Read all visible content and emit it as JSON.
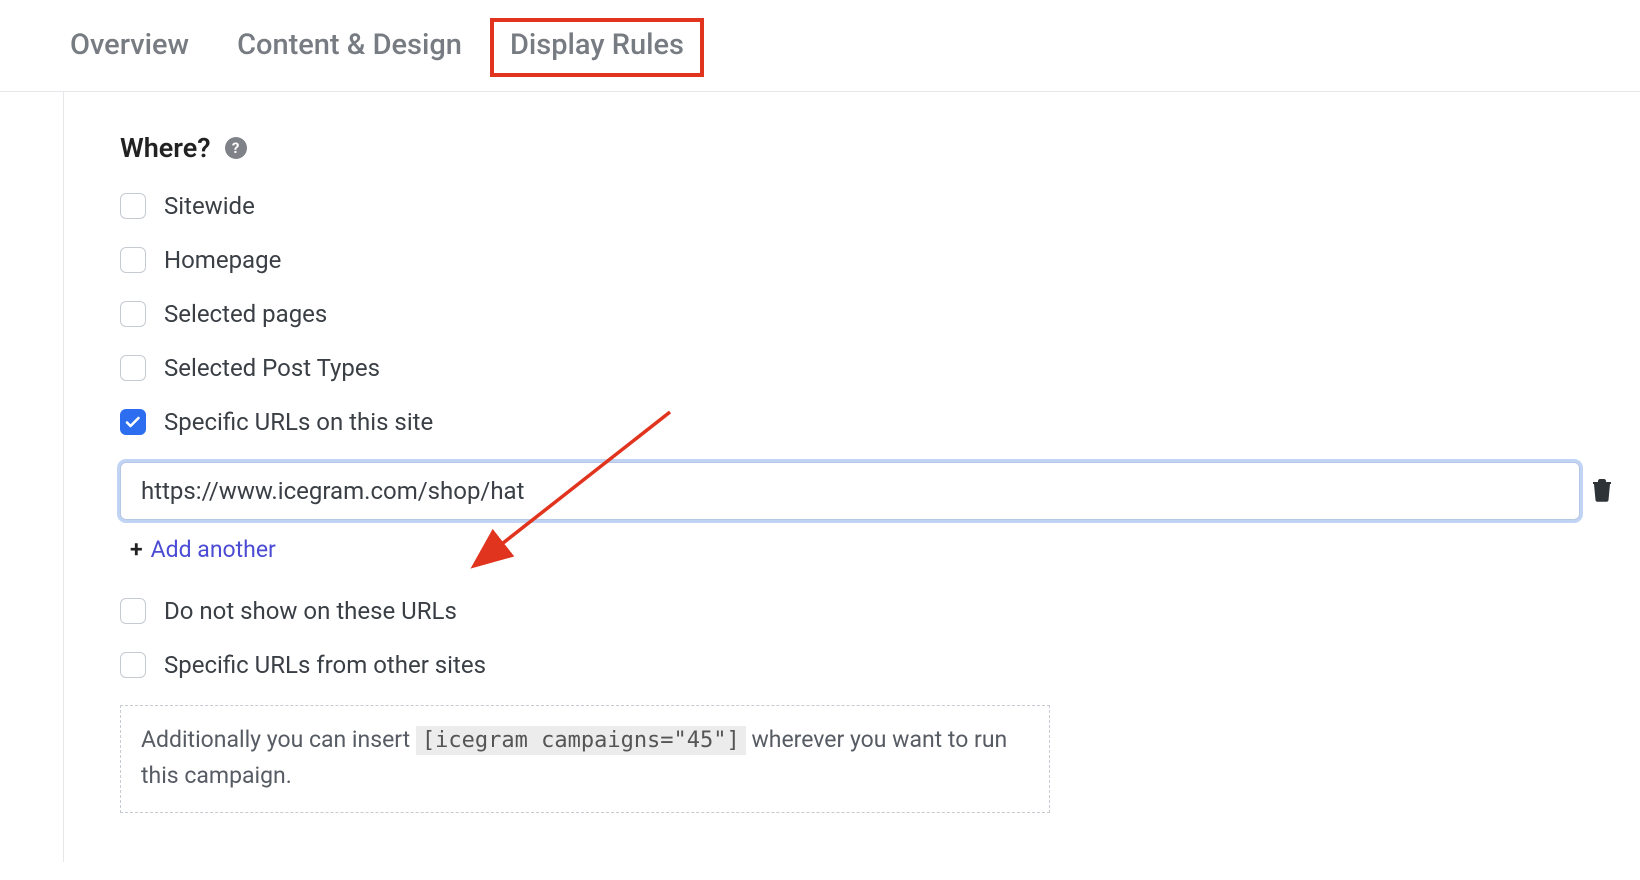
{
  "tabs": {
    "overview": "Overview",
    "content_design": "Content & Design",
    "display_rules": "Display Rules"
  },
  "section": {
    "title": "Where?"
  },
  "options": {
    "sitewide": "Sitewide",
    "homepage": "Homepage",
    "selected_pages": "Selected pages",
    "selected_post_types": "Selected Post Types",
    "specific_urls": "Specific URLs on this site",
    "do_not_show": "Do not show on these URLs",
    "other_sites": "Specific URLs from other sites"
  },
  "url_input": {
    "value": "https://www.icegram.com/shop/hat"
  },
  "add_another": {
    "plus": "+",
    "label": "Add another"
  },
  "shortcode_hint": {
    "prefix": "Additionally you can insert ",
    "code": "[icegram campaigns=\"45\"]",
    "suffix": " wherever you want to run this campaign."
  }
}
